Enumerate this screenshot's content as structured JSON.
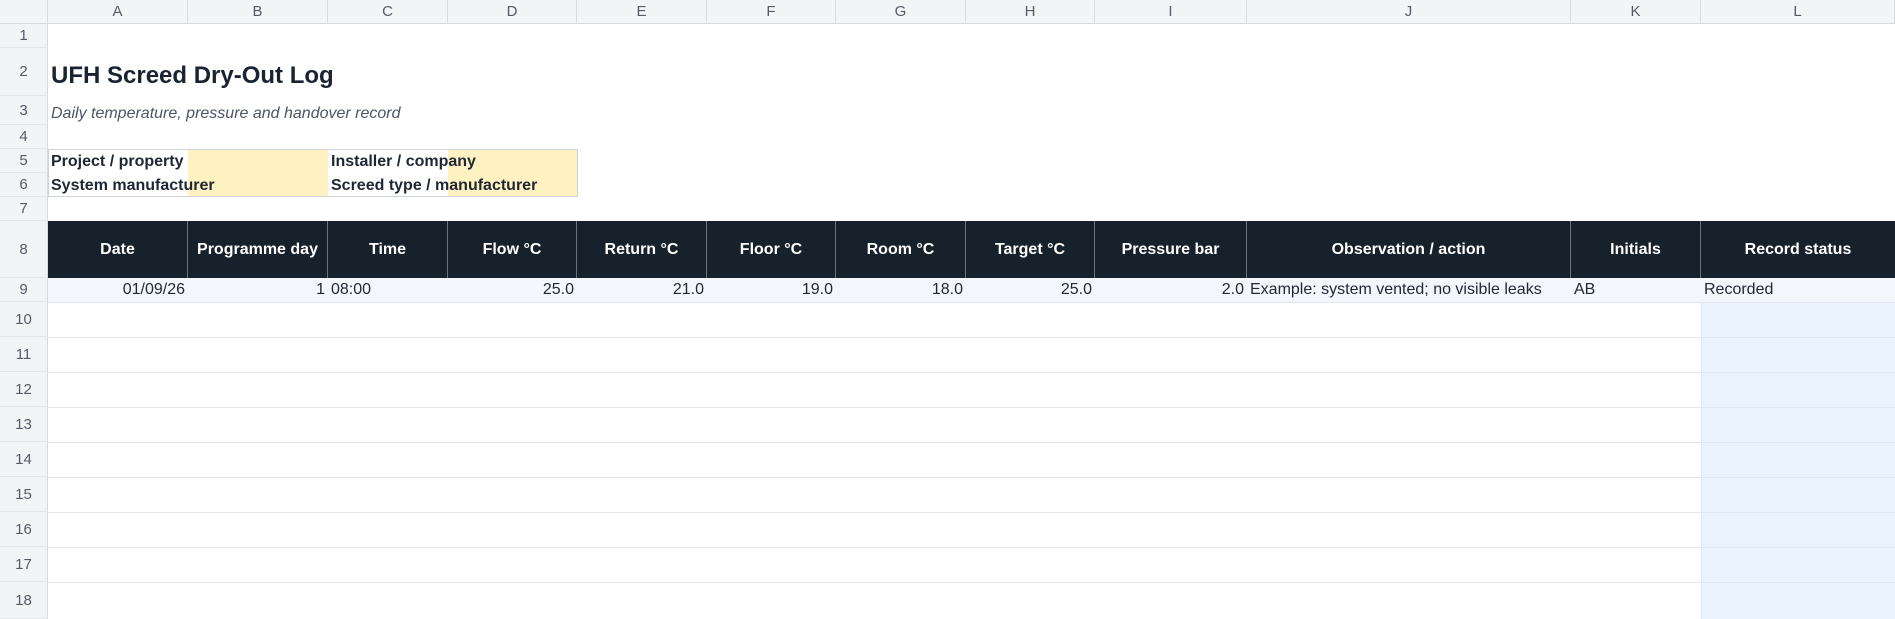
{
  "columns": [
    "A",
    "B",
    "C",
    "D",
    "E",
    "F",
    "G",
    "H",
    "I",
    "J",
    "K",
    "L"
  ],
  "rows": [
    "1",
    "2",
    "3",
    "4",
    "5",
    "6",
    "7",
    "8",
    "9",
    "10",
    "11",
    "12",
    "13",
    "14",
    "15",
    "16",
    "17",
    "18"
  ],
  "sheet": {
    "title": "UFH Screed Dry-Out Log",
    "subtitle": "Daily temperature, pressure and handover record",
    "meta": {
      "project_label": "Project / property",
      "system_label": "System manufacturer",
      "installer_label": "Installer / company",
      "screed_label": "Screed type / manufacturer"
    },
    "table": {
      "headers": [
        "Date",
        "Programme day",
        "Time",
        "Flow °C",
        "Return °C",
        "Floor °C",
        "Room °C",
        "Target °C",
        "Pressure bar",
        "Observation / action",
        "Initials",
        "Record status"
      ],
      "rows": [
        [
          "01/09/26",
          "1",
          "08:00",
          "25.0",
          "21.0",
          "19.0",
          "18.0",
          "25.0",
          "2.0",
          "Example: system vented; no visible leaks",
          "AB",
          "Recorded"
        ]
      ]
    }
  },
  "colors": {
    "header_bg": "#17212b",
    "input_fill": "#fff2c2",
    "status_fill": "#eaf3fd",
    "example_row_fill": "#f3f6fa"
  }
}
